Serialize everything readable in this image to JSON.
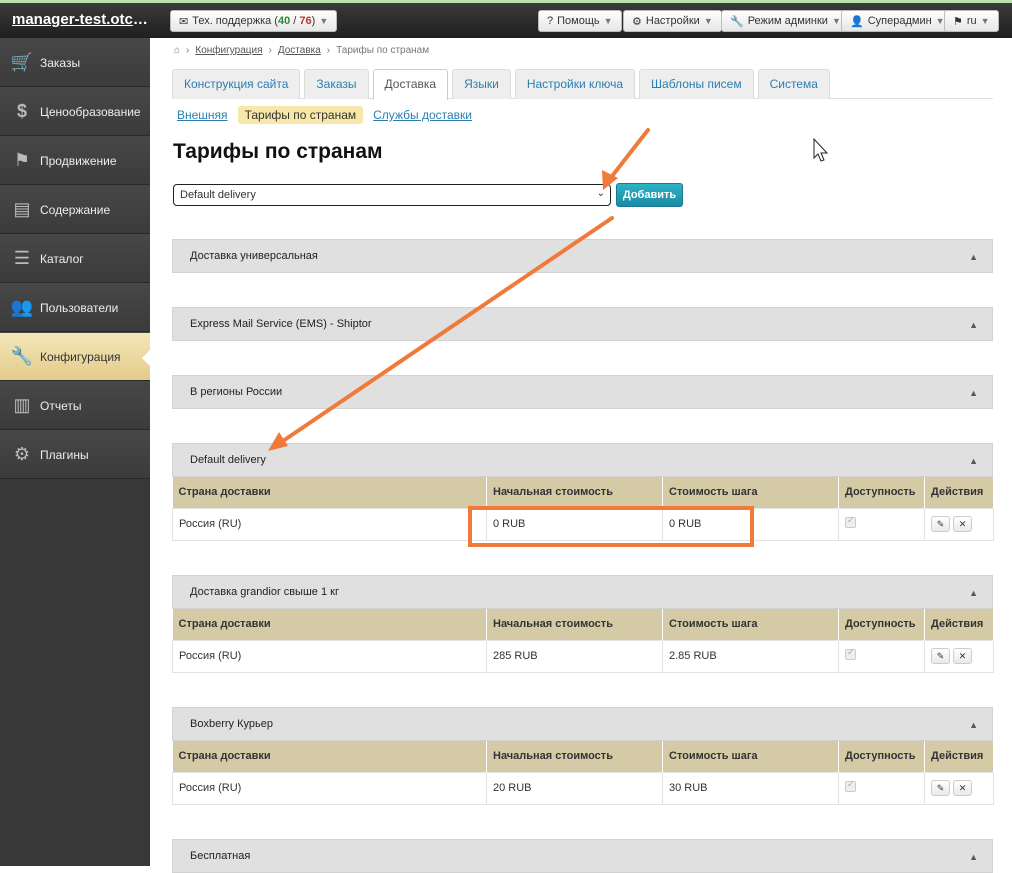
{
  "topbar": {
    "brand": "manager-test.otcom...",
    "support_prefix": "Тех. поддержка (",
    "support_open": "40",
    "support_sep": " / ",
    "support_total": "76",
    "support_suffix": ")",
    "help": "Помощь",
    "settings": "Настройки",
    "admin_mode": "Режим админки",
    "user": "Суперадмин",
    "lang": "ru"
  },
  "sidebar": {
    "items": [
      {
        "label": "Заказы",
        "icon": "cart-icon"
      },
      {
        "label": "Ценообразование",
        "icon": "dollar-icon"
      },
      {
        "label": "Продвижение",
        "icon": "flag-icon"
      },
      {
        "label": "Содержание",
        "icon": "document-icon"
      },
      {
        "label": "Каталог",
        "icon": "list-icon"
      },
      {
        "label": "Пользователи",
        "icon": "users-icon"
      },
      {
        "label": "Конфигурация",
        "icon": "wrench-icon"
      },
      {
        "label": "Отчеты",
        "icon": "bar-chart-icon"
      },
      {
        "label": "Плагины",
        "icon": "gear-icon"
      }
    ],
    "active": "Конфигурация"
  },
  "breadcrumb": [
    "Конфигурация",
    "Доставка",
    "Тарифы по странам"
  ],
  "tabs": [
    "Конструкция сайта",
    "Заказы",
    "Доставка",
    "Языки",
    "Настройки ключа",
    "Шаблоны писем",
    "Система"
  ],
  "active_tab": "Доставка",
  "subtabs": {
    "external": "Внешняя",
    "current": "Тарифы по странам",
    "services": "Службы доставки"
  },
  "page_title": "Тарифы по странам",
  "delivery_select": "Default delivery",
  "add_button": "Добавить",
  "table_headers": {
    "country": "Страна доставки",
    "start_cost": "Начальная стоимость",
    "step_cost": "Стоимость шага",
    "availability": "Доступность",
    "actions": "Действия"
  },
  "sections": [
    {
      "title": "Доставка универсальная"
    },
    {
      "title": "Express Mail Service (EMS) - Shiptor"
    },
    {
      "title": "В регионы России"
    },
    {
      "title": "Default delivery",
      "rows": [
        {
          "country": "Россия (RU)",
          "start": "0 RUB",
          "step": "0 RUB"
        }
      ]
    },
    {
      "title": "Доставка grandior свыше 1 кг",
      "rows": [
        {
          "country": "Россия (RU)",
          "start": "285 RUB",
          "step": "2.85 RUB"
        }
      ]
    },
    {
      "title": "Boxberry Курьер",
      "rows": [
        {
          "country": "Россия (RU)",
          "start": "20 RUB",
          "step": "30 RUB"
        }
      ]
    },
    {
      "title": "Бесплатная"
    }
  ],
  "colors": {
    "annotation": "#f07a3a",
    "accent": "#1b8aa3",
    "table_header": "#d4cba6"
  }
}
